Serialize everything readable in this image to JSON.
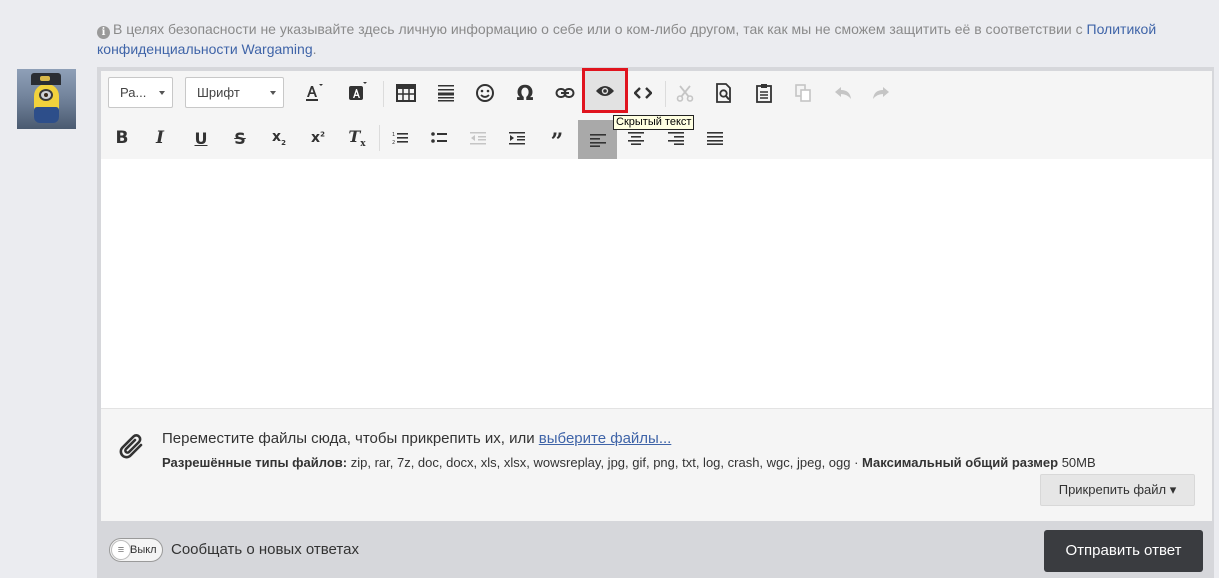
{
  "notice": {
    "text": "В целях безопасности не указывайте здесь личную информацию о себе или о ком-либо другом, так как мы не сможем защитить её в соответствии с ",
    "link": "Политикой конфиденциальности Wargaming",
    "end": "."
  },
  "toolbar": {
    "format_dropdown": "Ра...",
    "font_dropdown": "Шрифт",
    "tooltip": "Скрытый текст",
    "row1_icons": [
      "text-color-icon",
      "background-color-icon",
      "table-icon",
      "horizontal-rule-icon",
      "emoji-icon",
      "special-char-icon",
      "link-icon",
      "hidden-text-eye-icon",
      "code-icon",
      "cut-icon",
      "preview-icon",
      "paste-icon",
      "copy-icon",
      "undo-icon",
      "redo-icon"
    ],
    "row2_icons": [
      "bold-icon",
      "italic-icon",
      "underline-icon",
      "strikethrough-icon",
      "subscript-icon",
      "superscript-icon",
      "remove-format-icon",
      "numbered-list-icon",
      "bullet-list-icon",
      "outdent-icon",
      "indent-icon",
      "quote-icon",
      "align-left-icon",
      "align-center-icon",
      "align-right-icon",
      "justify-icon"
    ]
  },
  "attach": {
    "drop_text": "Переместите файлы сюда, чтобы прикрепить их, или ",
    "choose_link": "выберите файлы...",
    "types_label": "Разрешённые типы файлов:",
    "types_value": " zip, rar, 7z, doc, docx, xls, xlsx, wowsreplay, jpg, gif, png, txt, log, crash, wgc, jpeg, ogg · ",
    "max_label": "Максимальный общий размер",
    "max_value": " 50MB",
    "attach_button": "Прикрепить файл ▾"
  },
  "footer": {
    "toggle_text": "Выкл",
    "notify_label": "Сообщать о новых ответах",
    "submit_button": "Отправить ответ"
  },
  "colors": {
    "highlight_border": "#e0141e",
    "link": "#3f64a8",
    "submit_bg": "#3a3c40",
    "tooltip_bg": "#ffffe1"
  }
}
